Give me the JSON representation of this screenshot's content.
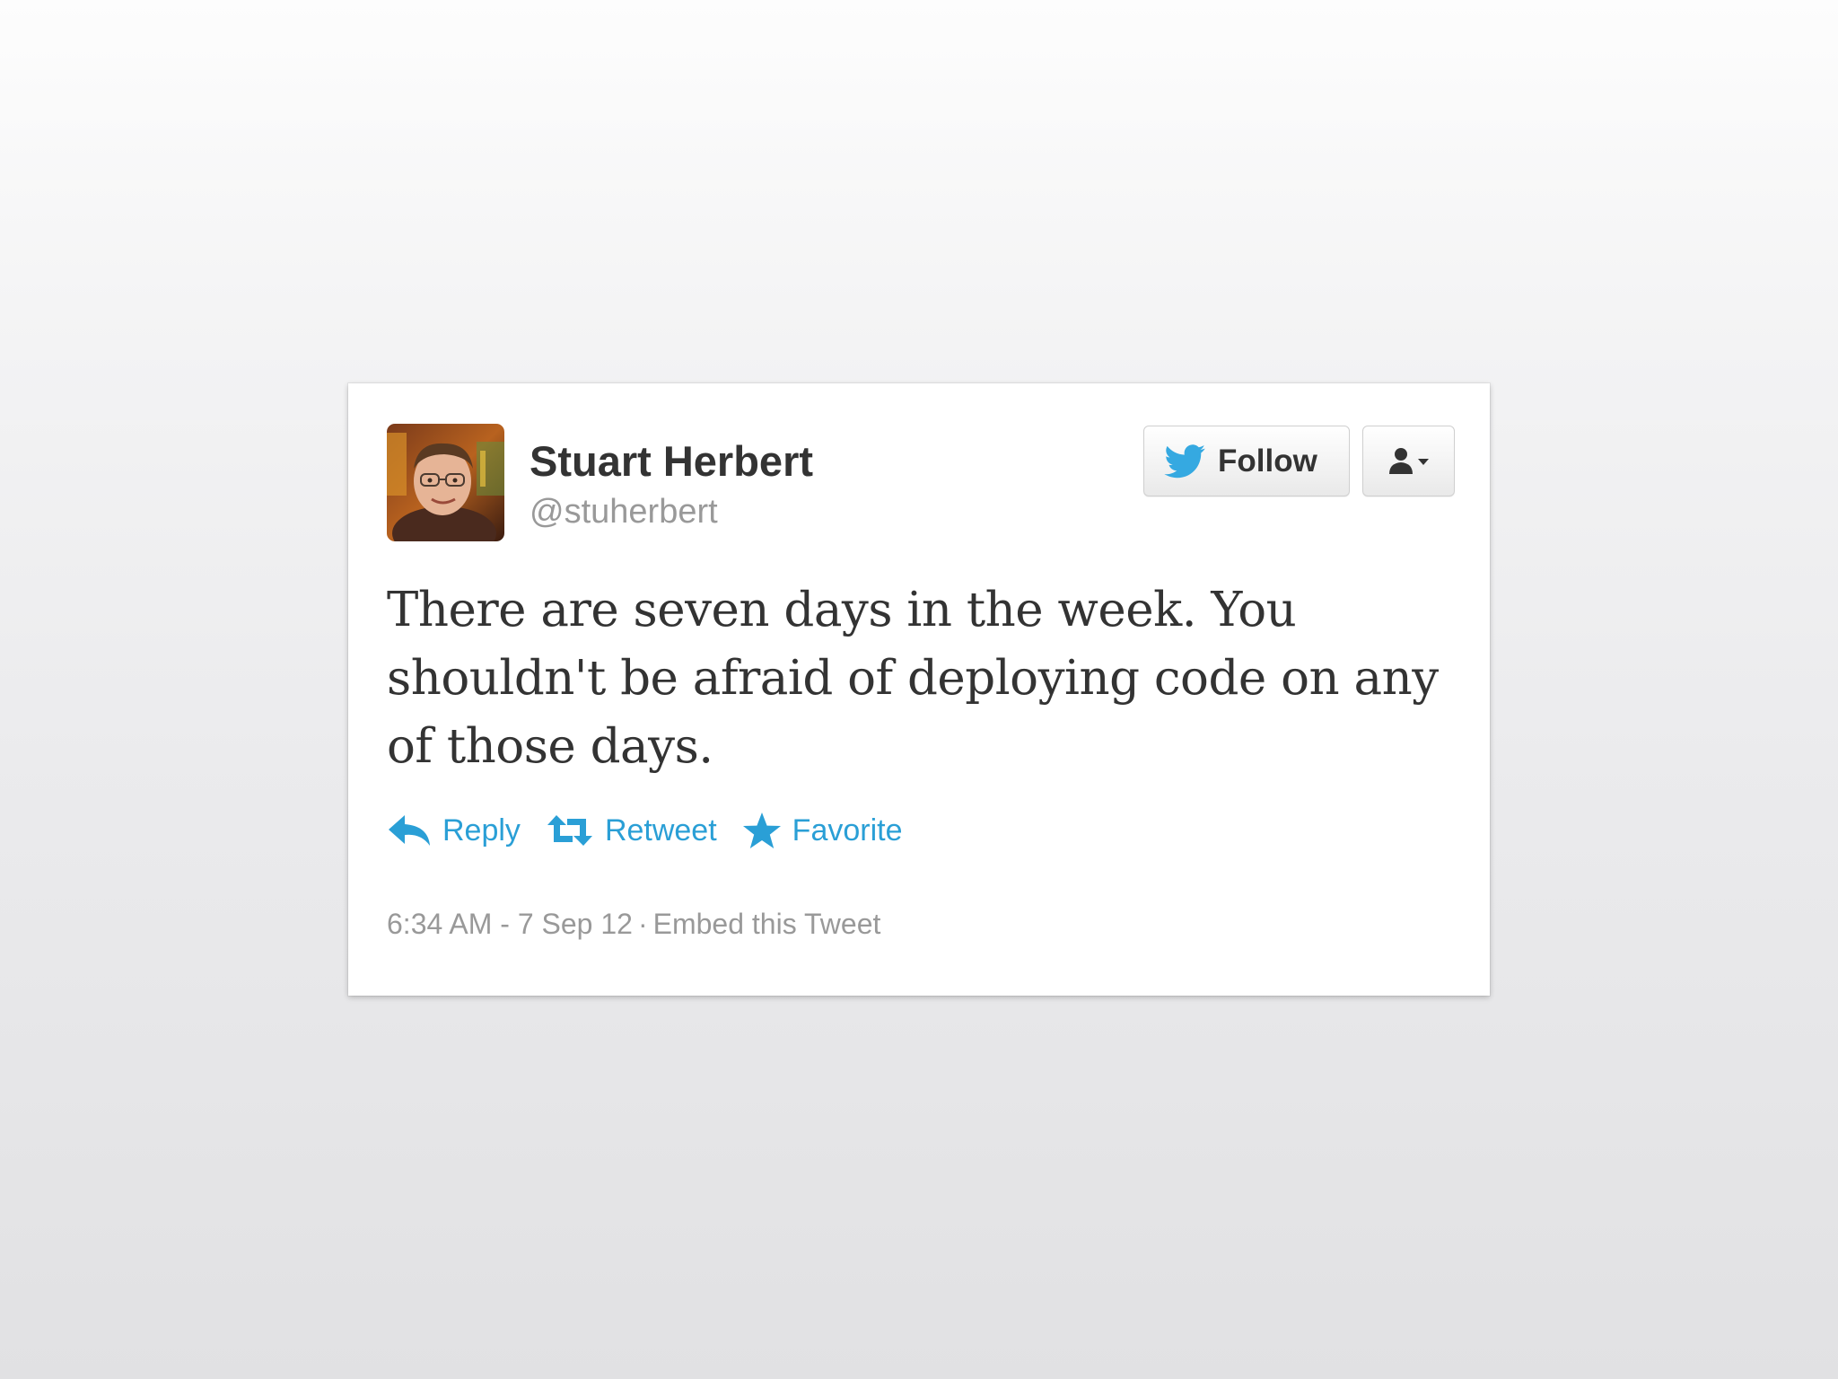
{
  "tweet": {
    "author": {
      "display_name": "Stuart Herbert",
      "screen_name": "@stuherbert"
    },
    "text": "There are seven days in the week. You shouldn't be afraid of deploying code on any of those days.",
    "follow_button": {
      "label": "Follow",
      "icon": "twitter-bird-icon"
    },
    "user_menu": {
      "icon": "user-dropdown-icon"
    },
    "actions": {
      "reply": {
        "label": "Reply",
        "icon": "reply-arrow-icon"
      },
      "retweet": {
        "label": "Retweet",
        "icon": "retweet-icon"
      },
      "favorite": {
        "label": "Favorite",
        "icon": "star-icon"
      }
    },
    "footer": {
      "timestamp": "6:34 AM - 7 Sep 12",
      "separator": "·",
      "embed_label": "Embed this Tweet"
    }
  },
  "colors": {
    "link_blue": "#2a9fd6",
    "bird_blue": "#35a9e1",
    "text_dark": "#333333",
    "text_muted": "#999999"
  }
}
